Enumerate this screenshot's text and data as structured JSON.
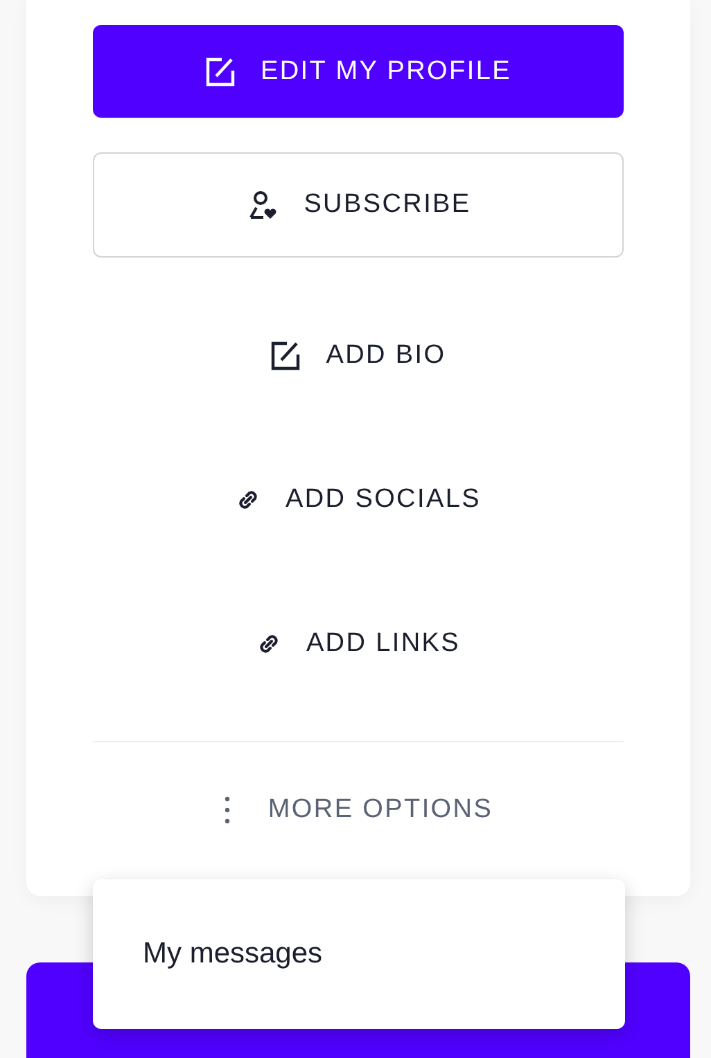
{
  "actions": [
    {
      "label": "EDIT MY PROFILE",
      "kind": "profile"
    },
    {
      "label": "SUBSCRIBE",
      "kind": "subscribe"
    },
    {
      "label": "ADD BIO",
      "kind": "bio"
    },
    {
      "label": "ADD SOCIALS",
      "kind": "socials"
    },
    {
      "label": "ADD LINKS",
      "kind": "links"
    }
  ],
  "more_options": {
    "label": "MORE OPTIONS",
    "expanded": true
  },
  "menu": {
    "items": [
      "My messages"
    ]
  }
}
